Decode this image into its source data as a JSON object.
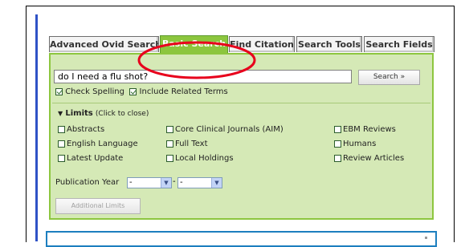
{
  "tabs": [
    {
      "label": "Advanced Ovid Search",
      "active": false
    },
    {
      "label": "Basic Search",
      "active": true
    },
    {
      "label": "Find Citation",
      "active": false
    },
    {
      "label": "Search Tools",
      "active": false
    },
    {
      "label": "Search Fields",
      "active": false
    }
  ],
  "search": {
    "value": "do I need a flu shot?",
    "button_label": "Search »"
  },
  "options": {
    "check_spelling": {
      "label": "Check Spelling",
      "checked": true
    },
    "related_terms": {
      "label": "Include Related Terms",
      "checked": true
    }
  },
  "limits": {
    "title": "Limits",
    "hint": "(Click to close)",
    "items": [
      {
        "label": "Abstracts",
        "checked": false
      },
      {
        "label": "Core Clinical Journals (AIM)",
        "checked": false
      },
      {
        "label": "EBM Reviews",
        "checked": false
      },
      {
        "label": "English Language",
        "checked": false
      },
      {
        "label": "Full Text",
        "checked": false
      },
      {
        "label": "Humans",
        "checked": false
      },
      {
        "label": "Latest Update",
        "checked": false
      },
      {
        "label": "Local Holdings",
        "checked": false
      },
      {
        "label": "Review Articles",
        "checked": false
      }
    ]
  },
  "publication_year": {
    "label": "Publication Year",
    "from": "-",
    "separator": "-",
    "to": "-"
  },
  "additional_limits_label": "Additional Limits",
  "colors": {
    "active_tab": "#8cc63e",
    "panel_bg": "#d5e9b6",
    "annotation": "#e8001c",
    "accent_blue": "#2f52c6"
  }
}
